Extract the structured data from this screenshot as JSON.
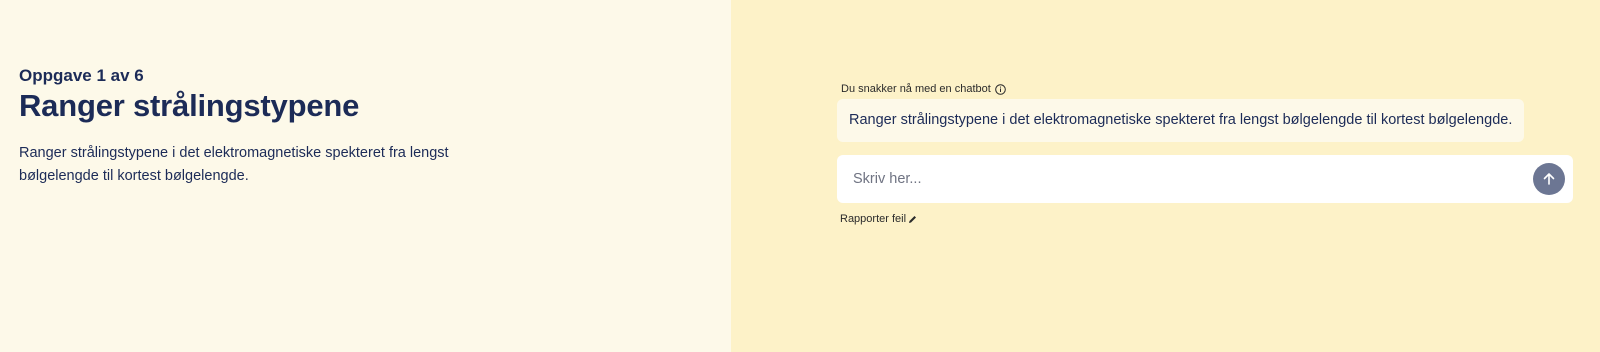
{
  "task": {
    "counter": "Oppgave 1 av 6",
    "title": "Ranger strålingstypene",
    "description": "Ranger strålingstypene i det elektromagnetiske spekteret fra lengst bølgelengde til kortest bølgelengde."
  },
  "chat": {
    "note": "Du snakker nå med en chatbot",
    "note_icon": "info-icon",
    "message": "Ranger strålingstypene i det elektromagnetiske spekteret fra lengst bølgelengde til kortest bølgelengde.",
    "input_placeholder": "Skriv her...",
    "input_value": "",
    "send_icon": "arrow-up-icon",
    "report_label": "Rapporter feil",
    "report_icon": "pencil-icon"
  },
  "colors": {
    "left_background": "#fdf9e9",
    "right_background": "#fdf2c8",
    "text_primary": "#1c2b57",
    "send_button": "#6c7693"
  }
}
